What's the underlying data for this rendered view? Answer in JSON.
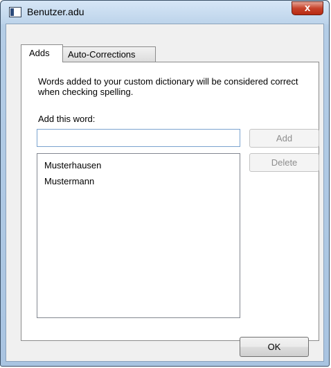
{
  "window": {
    "title": "Benutzer.adu",
    "close_label": "x"
  },
  "tabs": [
    {
      "label": "Adds",
      "active": true
    },
    {
      "label": "Auto-Corrections",
      "active": false
    }
  ],
  "adds": {
    "description": "Words added to your custom dictionary will be considered correct when checking spelling.",
    "add_word_label": "Add this word:",
    "add_word_value": "",
    "add_button": "Add",
    "delete_button": "Delete",
    "words": [
      "Musterhausen",
      "Mustermann"
    ]
  },
  "footer": {
    "ok_button": "OK"
  },
  "colors": {
    "close_button": "#c7432b",
    "input_border": "#7aa3cf",
    "window_frame": "#b4cde6"
  }
}
